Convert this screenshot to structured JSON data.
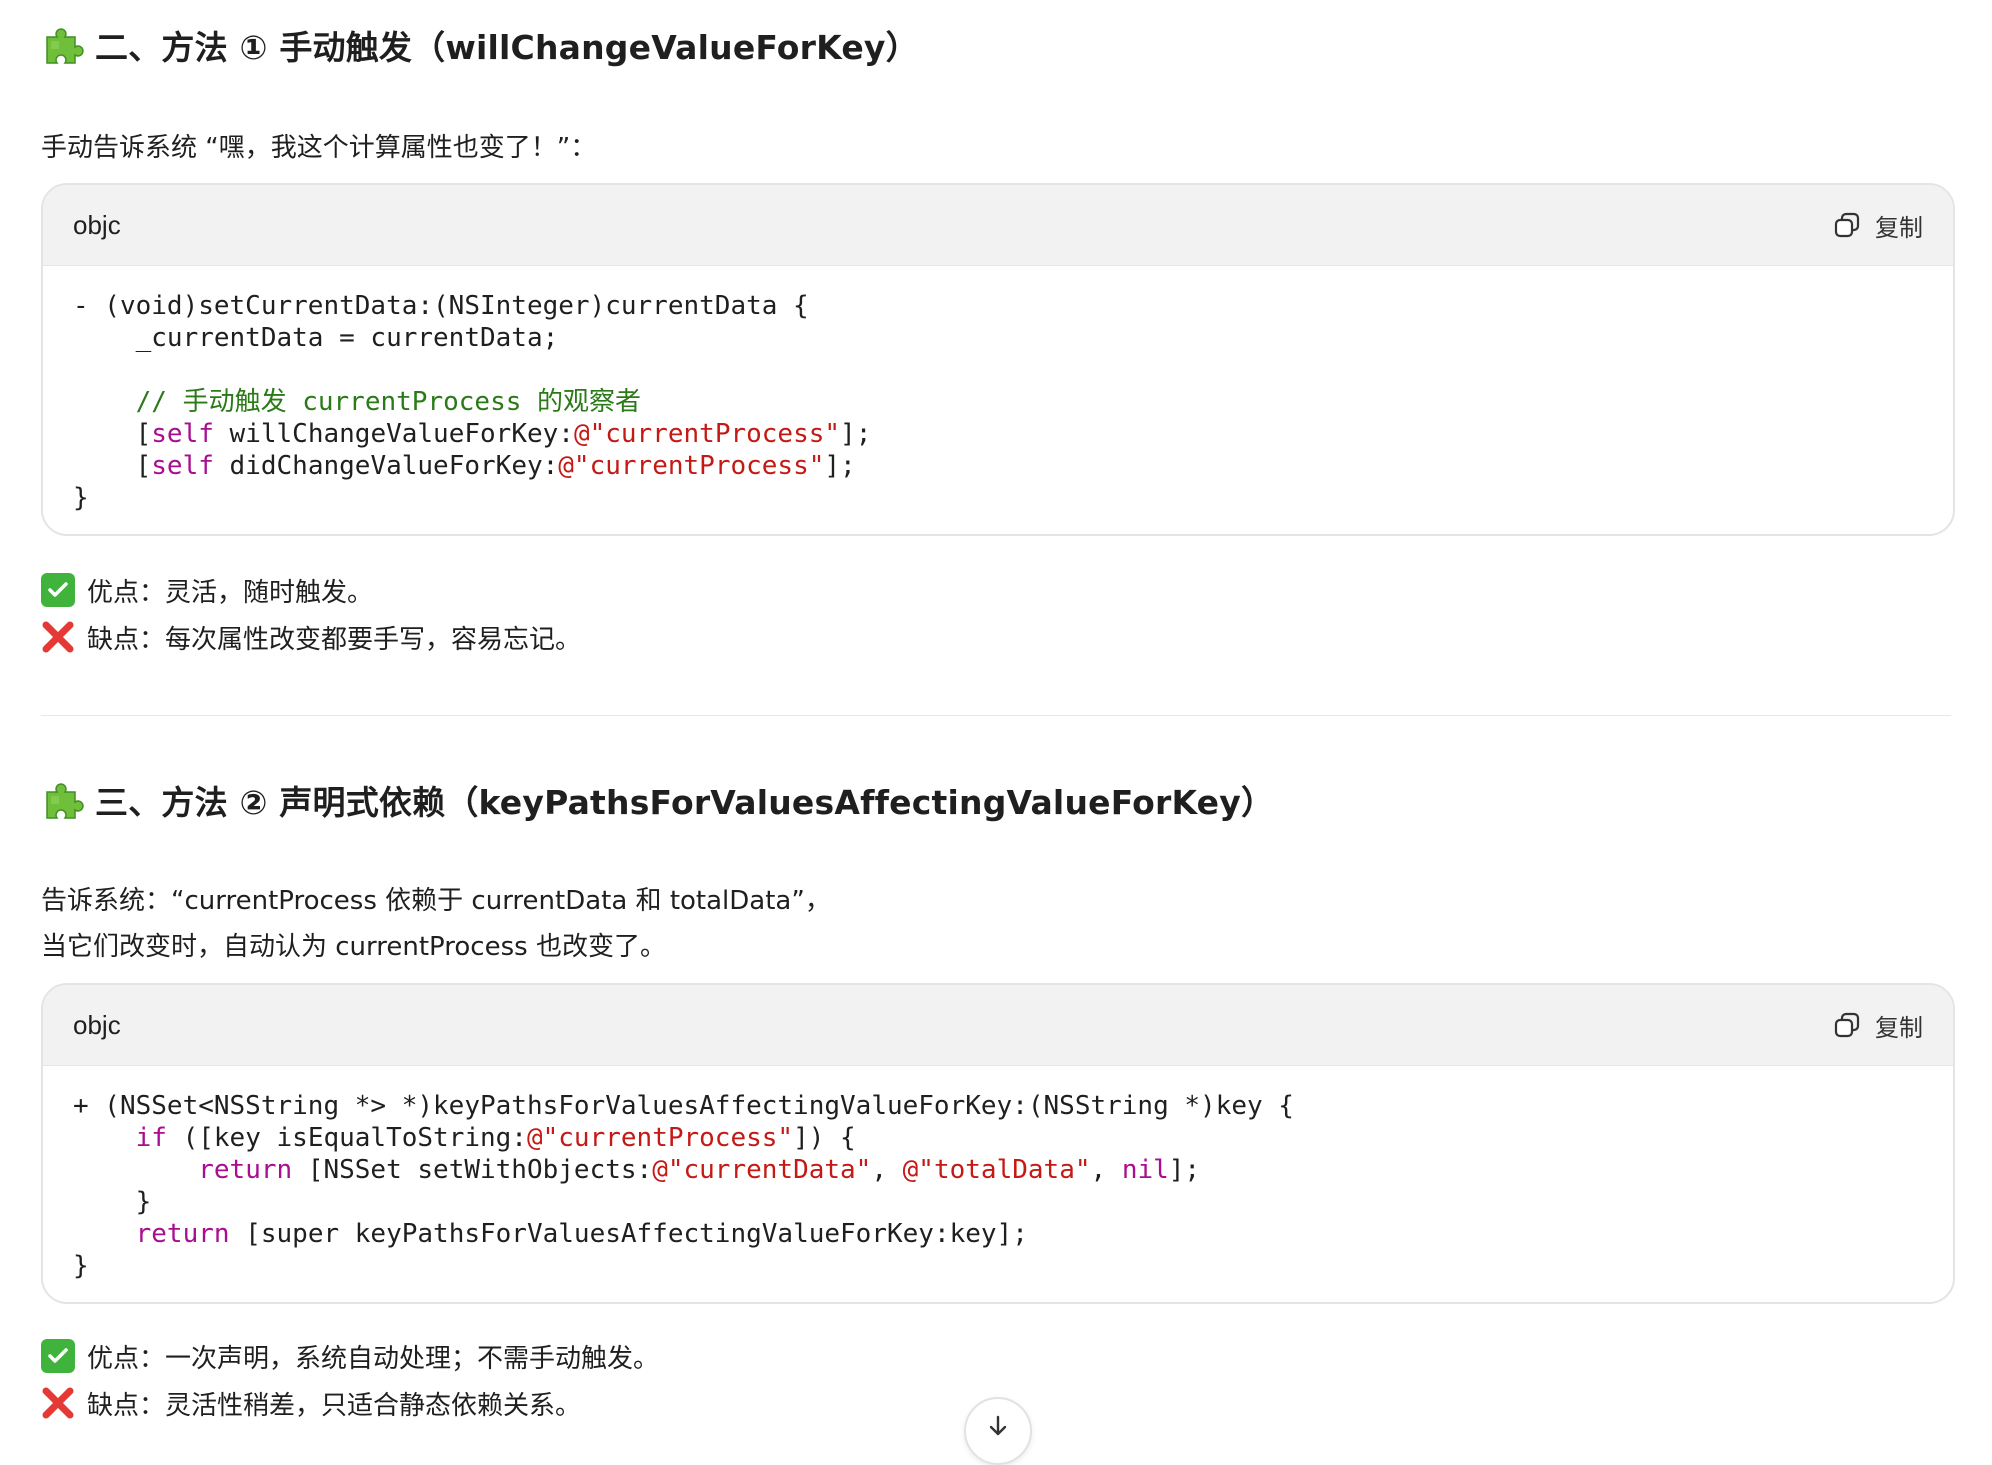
{
  "section2": {
    "heading": "二、方法 ① 手动触发（willChangeValueForKey）",
    "intro": "手动告诉系统 “嘿，我这个计算属性也变了！”：",
    "code": {
      "lang": "objc",
      "copy_label": "复制",
      "lines": {
        "l1": "- (void)setCurrentData:(NSInteger)currentData {",
        "l2": "    _currentData = currentData;",
        "l4": "    // 手动触发 currentProcess 的观察者",
        "l5a": "    [",
        "self": "self",
        "l5b": " willChangeValueForKey:",
        "l5s": "@\"currentProcess\"",
        "l5c": "];",
        "l6b": " didChangeValueForKey:",
        "l7": "}"
      }
    },
    "pro": "优点：灵活，随时触发。",
    "con": "缺点：每次属性改变都要手写，容易忘记。"
  },
  "section3": {
    "heading": "三、方法 ② 声明式依赖（keyPathsForValuesAffectingValueForKey）",
    "intro1": "告诉系统：“currentProcess 依赖于 currentData 和 totalData”，",
    "intro2": "当它们改变时，自动认为 currentProcess 也改变了。",
    "code": {
      "lang": "objc",
      "copy_label": "复制",
      "lines": {
        "l1": "+ (NSSet<NSString *> *)keyPathsForValuesAffectingValueForKey:(NSString *)key {",
        "if": "if",
        "l2a": " ([key isEqualToString:",
        "l2s": "@\"currentProcess\"",
        "l2b": "]) {",
        "return": "return",
        "l3a": " [NSSet setWithObjects:",
        "l3s1": "@\"currentData\"",
        "comma": ", ",
        "l3s2": "@\"totalData\"",
        "nil": "nil",
        "l3b": "];",
        "l4": "    }",
        "l5a": " [super keyPathsForValuesAffectingValueForKey:key];",
        "l6": "}"
      }
    },
    "pro": "优点：一次声明，系统自动处理；不需手动触发。",
    "con": "缺点：灵活性稍差，只适合静态依赖关系。"
  },
  "colors": {
    "keyword": "#a90d91",
    "string": "#c41a16",
    "comment": "#2a7b17",
    "check": "#3fb33b",
    "cross": "#e53935"
  }
}
